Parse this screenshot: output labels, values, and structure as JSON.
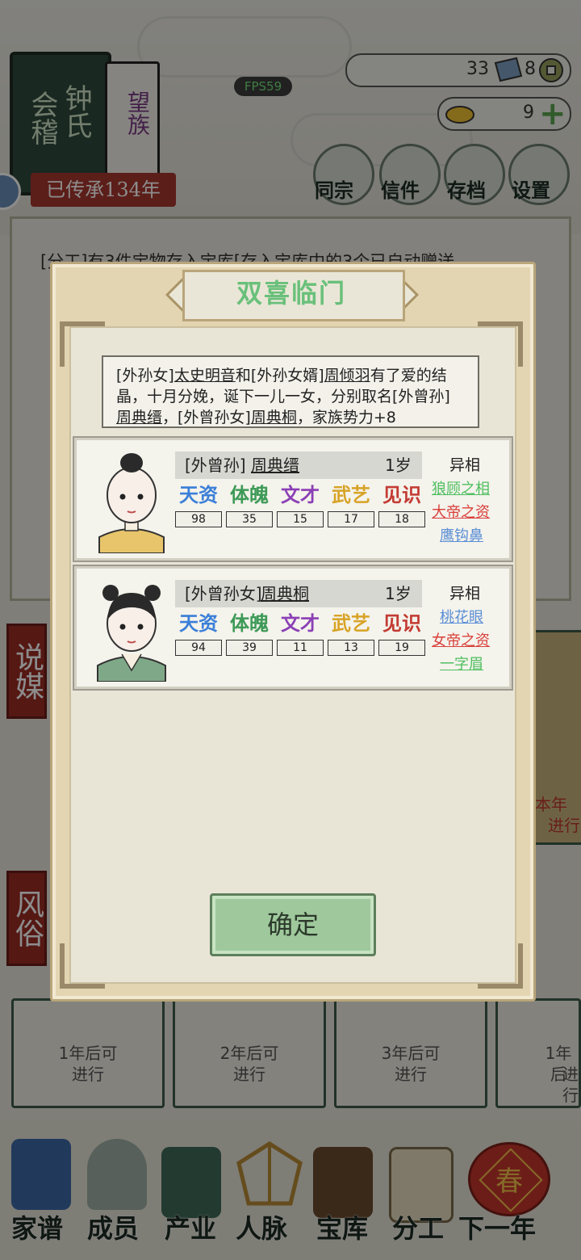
{
  "header": {
    "clan_place": "会稽",
    "clan_surname": "钟氏",
    "clan_rank": "望族",
    "inherit_text": "已传承134年",
    "fps": "FPS59",
    "resource_a": "33",
    "resource_b": "8",
    "gold": "9",
    "menu": [
      {
        "label": "同宗",
        "icon": "clan-book-icon"
      },
      {
        "label": "信件",
        "icon": "letter-icon"
      },
      {
        "label": "存档",
        "icon": "save-icon"
      },
      {
        "label": "设置",
        "icon": "gear-icon"
      }
    ]
  },
  "news_line": "[分工]有3件宝物存入宝库[存入宝库中的3个已自动赠送",
  "side_tabs": {
    "matchmaking": "说媒",
    "customs": "风俗"
  },
  "slots": [
    {
      "line1": "1年后可",
      "line2": "进行"
    },
    {
      "line1": "2年后可",
      "line2": "进行"
    },
    {
      "line1": "3年后可",
      "line2": "进行"
    },
    {
      "line1": "1年后",
      "line2": "进行"
    }
  ],
  "right_panel_text": {
    "line1": "本年",
    "line2": "进行"
  },
  "bottom_nav": [
    {
      "label": "家谱",
      "icon": "family-tree-icon"
    },
    {
      "label": "成员",
      "icon": "member-icon"
    },
    {
      "label": "产业",
      "icon": "industry-icon"
    },
    {
      "label": "人脉",
      "icon": "network-icon"
    },
    {
      "label": "宝库",
      "icon": "treasury-icon"
    },
    {
      "label": "分工",
      "icon": "scroll-icon"
    },
    {
      "label": "下一年",
      "icon": "lantern-icon"
    }
  ],
  "lantern_char": "春",
  "dialog": {
    "title": "双喜临门",
    "story": {
      "p1": "[外孙女]",
      "mother": "太史明音",
      "p2": "和[外孙女婿]",
      "father": "周倾羽",
      "p3": "有了爱的结晶，十月分娩，诞下一儿一女，分别取名[外曾孙]",
      "son": "周典缙",
      "p4": "，[外曾孙女]",
      "daughter": "周典桐",
      "p5": "，家族势力+8"
    },
    "confirm": "确定",
    "stat_names": [
      "天资",
      "体魄",
      "文才",
      "武艺",
      "见识"
    ],
    "stat_colors": [
      "#3a7fd8",
      "#3e9a57",
      "#8b3fb5",
      "#d8a326",
      "#c33b33"
    ],
    "trait_heading": "异相",
    "children": [
      {
        "relation": "[外曾孙]",
        "name": "周典缙",
        "age": "1岁",
        "stats": [
          "98",
          "35",
          "15",
          "17",
          "18"
        ],
        "traits": [
          {
            "text": "狼顾之相",
            "color": "#4fbf5f"
          },
          {
            "text": "大帝之资",
            "color": "#d9403a"
          },
          {
            "text": "鹰钩鼻",
            "color": "#5b8fd6"
          }
        ]
      },
      {
        "relation": "[外曾孙女]",
        "name": "周典桐",
        "age": "1岁",
        "stats": [
          "94",
          "39",
          "11",
          "13",
          "19"
        ],
        "traits": [
          {
            "text": "桃花眼",
            "color": "#5b8fd6"
          },
          {
            "text": "女帝之资",
            "color": "#d9403a"
          },
          {
            "text": "一字眉",
            "color": "#4fbf5f"
          }
        ]
      }
    ]
  }
}
